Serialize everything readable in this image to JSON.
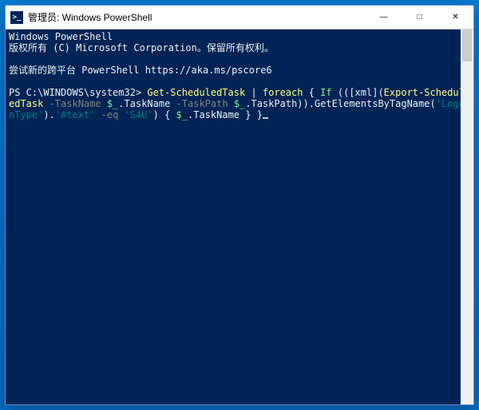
{
  "window": {
    "title": "管理员: Windows PowerShell",
    "icon_text": ">_"
  },
  "controls": {
    "minimize": "—",
    "maximize": "□",
    "close": "✕"
  },
  "terminal": {
    "header1": "Windows PowerShell",
    "header2": "版权所有 (C) Microsoft Corporation。保留所有权利。",
    "tip_prefix": "尝试新的跨平台 PowerShell ",
    "tip_url": "https://aka.ms/pscore6",
    "prompt": "PS C:\\WINDOWS\\system32> ",
    "cmd": {
      "p1": "Get-ScheduledTask",
      "pipe1": " | ",
      "p2": "foreach",
      "brace1": " { ",
      "if": "If",
      "paren1": " ((",
      "xml_open": "[xml]",
      "paren2": "(",
      "export": "Export-ScheduledTask",
      "param1": " -TaskName ",
      "var1": "$_",
      "prop1": ".TaskName",
      "param2": " -TaskPath ",
      "var2": "$_",
      "prop2": ".TaskPath",
      "close1": ")).",
      "method": "GetElementsByTagName",
      "paren3": "(",
      "str1": "'LogonType'",
      "close2": ").",
      "str2": "'#text'",
      "eq": " -eq ",
      "str3": "'S4U'",
      "close3": ") { ",
      "var3": "$_",
      "prop3": ".TaskName",
      "close4": " } }"
    }
  }
}
